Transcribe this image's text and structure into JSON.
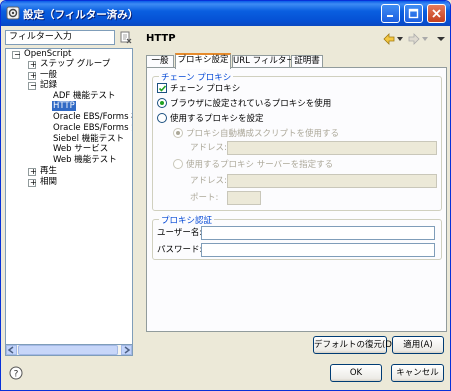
{
  "window": {
    "title": "設定（フィルター済み）"
  },
  "filter": {
    "placeholder": "フィルター入力"
  },
  "tree": {
    "root": "OpenScript",
    "items": [
      {
        "label": "ステップ グループ",
        "expander": "+"
      },
      {
        "label": "一般",
        "expander": "+"
      },
      {
        "label": "記録",
        "expander": "−"
      },
      {
        "label": "ADF 機能テスト"
      },
      {
        "label": "HTTP",
        "selected": true
      },
      {
        "label": "Oracle EBS/Forms 機"
      },
      {
        "label": "Oracle EBS/Forms 負"
      },
      {
        "label": "Siebel 機能テスト"
      },
      {
        "label": "Web サービス"
      },
      {
        "label": "Web 機能テスト"
      },
      {
        "label": "再生",
        "expander": "+"
      },
      {
        "label": "相関",
        "expander": "+"
      }
    ]
  },
  "page": {
    "title": "HTTP"
  },
  "tabs": [
    {
      "label": "一般",
      "active": false
    },
    {
      "label": "プロキシ設定",
      "active": true
    },
    {
      "label": "URL フィルター",
      "active": false
    },
    {
      "label": "証明書",
      "active": false
    }
  ],
  "chain_proxy": {
    "group_title": "チェーン プロキシ",
    "chain_checkbox": {
      "label": "チェーン プロキシ",
      "checked": true
    },
    "browser_radio": {
      "label": "ブラウザに設定されているプロキシを使用",
      "selected": true
    },
    "use_proxy_radio": {
      "label": "使用するプロキシを設定",
      "selected": false
    },
    "auto_script_radio": {
      "label": "プロキシ自動構成スクリプトを使用する",
      "selected": true
    },
    "address_label_1": "アドレス:",
    "specify_server_radio": {
      "label": "使用するプロキシ サーバーを指定する",
      "selected": false
    },
    "address_label_2": "アドレス:",
    "port_label": "ポート:"
  },
  "proxy_auth": {
    "group_title": "プロキシ認証",
    "username_label": "ユーザー名:",
    "password_label": "パスワード:"
  },
  "buttons": {
    "restore_defaults": "デフォルトの復元(D)",
    "apply": "適用(A)",
    "ok": "OK",
    "cancel": "キャンセル"
  }
}
